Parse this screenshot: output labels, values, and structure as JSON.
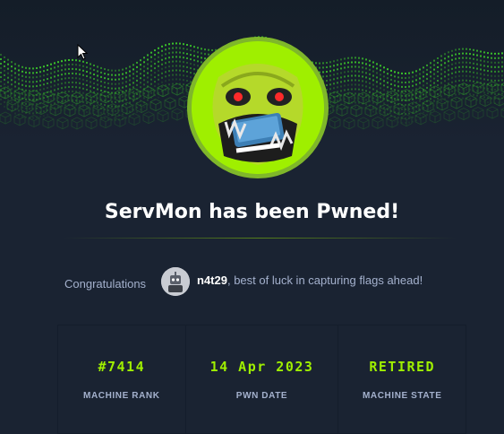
{
  "title": "ServMon has been Pwned!",
  "congrats": {
    "label": "Congratulations",
    "username": "n4t29",
    "message": ", best of luck in capturing flags ahead!"
  },
  "stats": [
    {
      "value": "#7414",
      "label": "MACHINE RANK"
    },
    {
      "value": "14 Apr 2023",
      "label": "PWN DATE"
    },
    {
      "value": "RETIRED",
      "label": "MACHINE STATE"
    }
  ],
  "colors": {
    "accent": "#9fef00",
    "background": "#1a2332",
    "muted_text": "#a4b1cd"
  },
  "icons": {
    "machine_logo": "monster-face-icon",
    "avatar": "robot-avatar-icon",
    "cursor": "mouse-pointer-icon"
  }
}
